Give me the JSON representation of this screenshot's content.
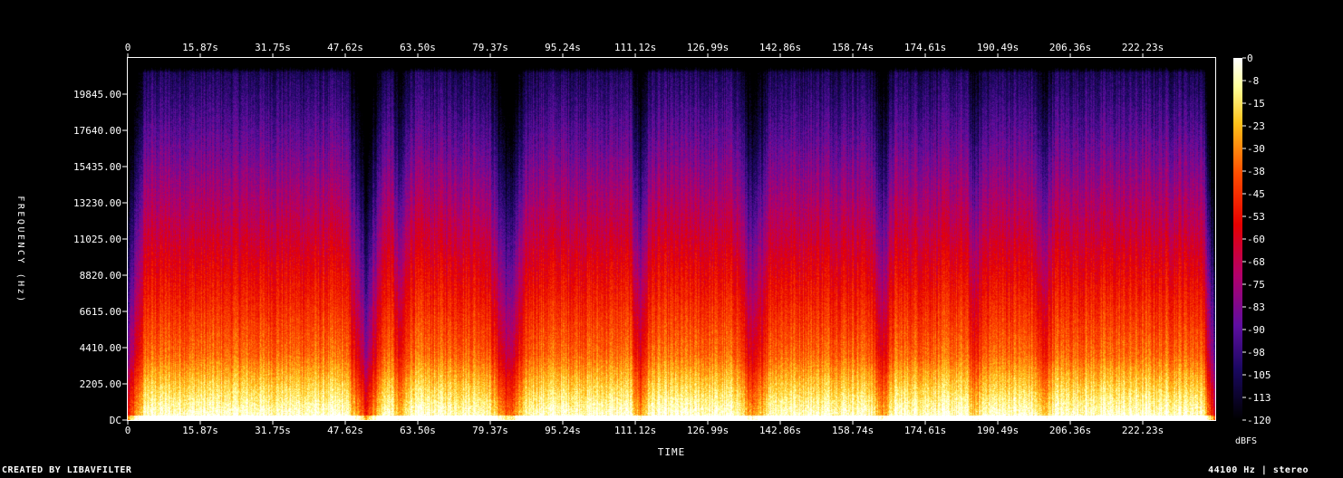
{
  "chart_data": {
    "type": "heatmap",
    "title": "",
    "xlabel": "TIME",
    "ylabel": "FREQUENCY (Hz)",
    "x_ticks": [
      "0",
      "15.87s",
      "31.75s",
      "47.62s",
      "63.50s",
      "79.37s",
      "95.24s",
      "111.12s",
      "126.99s",
      "142.86s",
      "158.74s",
      "174.61s",
      "190.49s",
      "206.36s",
      "222.23s"
    ],
    "x_tick_values": [
      0,
      15.87,
      31.75,
      47.62,
      63.5,
      79.37,
      95.24,
      111.12,
      126.99,
      142.86,
      158.74,
      174.61,
      190.49,
      206.36,
      222.23
    ],
    "xlim": [
      0,
      238.1
    ],
    "y_ticks": [
      "DC",
      "2205.00",
      "4410.00",
      "6615.00",
      "8820.00",
      "11025.00",
      "13230.00",
      "15435.00",
      "17640.00",
      "19845.00"
    ],
    "y_tick_values": [
      0,
      2205,
      4410,
      6615,
      8820,
      11025,
      13230,
      15435,
      17640,
      19845
    ],
    "ylim": [
      0,
      22050
    ],
    "colorbar": {
      "label": "dBFS",
      "ticks": [
        "0",
        "-8",
        "-15",
        "-23",
        "-30",
        "-38",
        "-45",
        "-53",
        "-60",
        "-68",
        "-75",
        "-83",
        "-90",
        "-98",
        "-105",
        "-113",
        "-120"
      ],
      "range": [
        -120,
        0
      ]
    },
    "colors": {
      "background": "#000000",
      "frame": "#ffffff",
      "text": "#ffffff"
    }
  },
  "footer": {
    "left": "CREATED BY LIBAVFILTER",
    "right": "44100 Hz | stereo"
  }
}
